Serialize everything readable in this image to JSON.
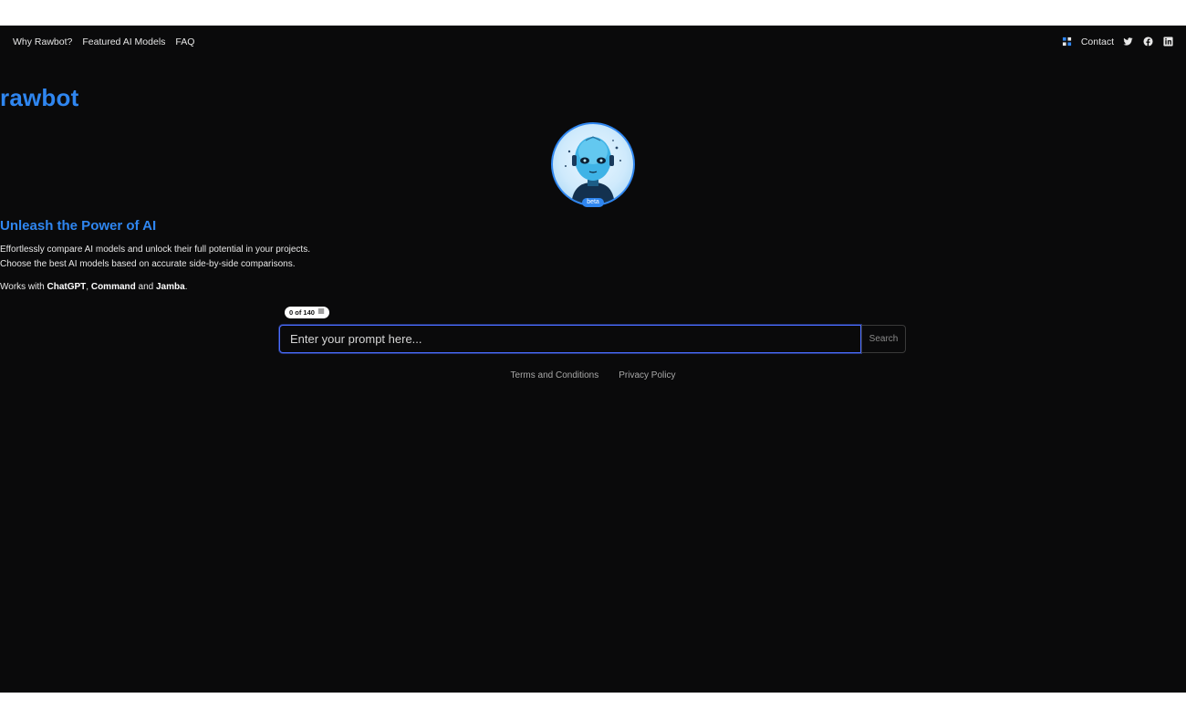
{
  "nav": {
    "left": [
      "Why Rawbot?",
      "Featured AI Models",
      "FAQ"
    ],
    "contact": "Contact",
    "icons": [
      "theme-toggle-icon",
      "twitter-icon",
      "facebook-icon",
      "linkedin-icon"
    ]
  },
  "brand": "rawbot",
  "beta": "beta",
  "tagline": "Unleash the Power of AI",
  "description": [
    "Effortlessly compare AI models and unlock their full potential in your projects.",
    "Choose the best AI models based on accurate side-by-side comparisons."
  ],
  "works": {
    "prefix": "Works with ",
    "m1": "ChatGPT",
    "sep1": ", ",
    "m2": "Command",
    "sep2": " and ",
    "m3": "Jamba",
    "suffix": "."
  },
  "counter": "0 of 140",
  "search": {
    "placeholder": "Enter your prompt here...",
    "button": "Search"
  },
  "footer": [
    "Terms and Conditions",
    "Privacy Policy"
  ],
  "colors": {
    "accent": "#2f86f0",
    "background": "#0a0a0b"
  }
}
